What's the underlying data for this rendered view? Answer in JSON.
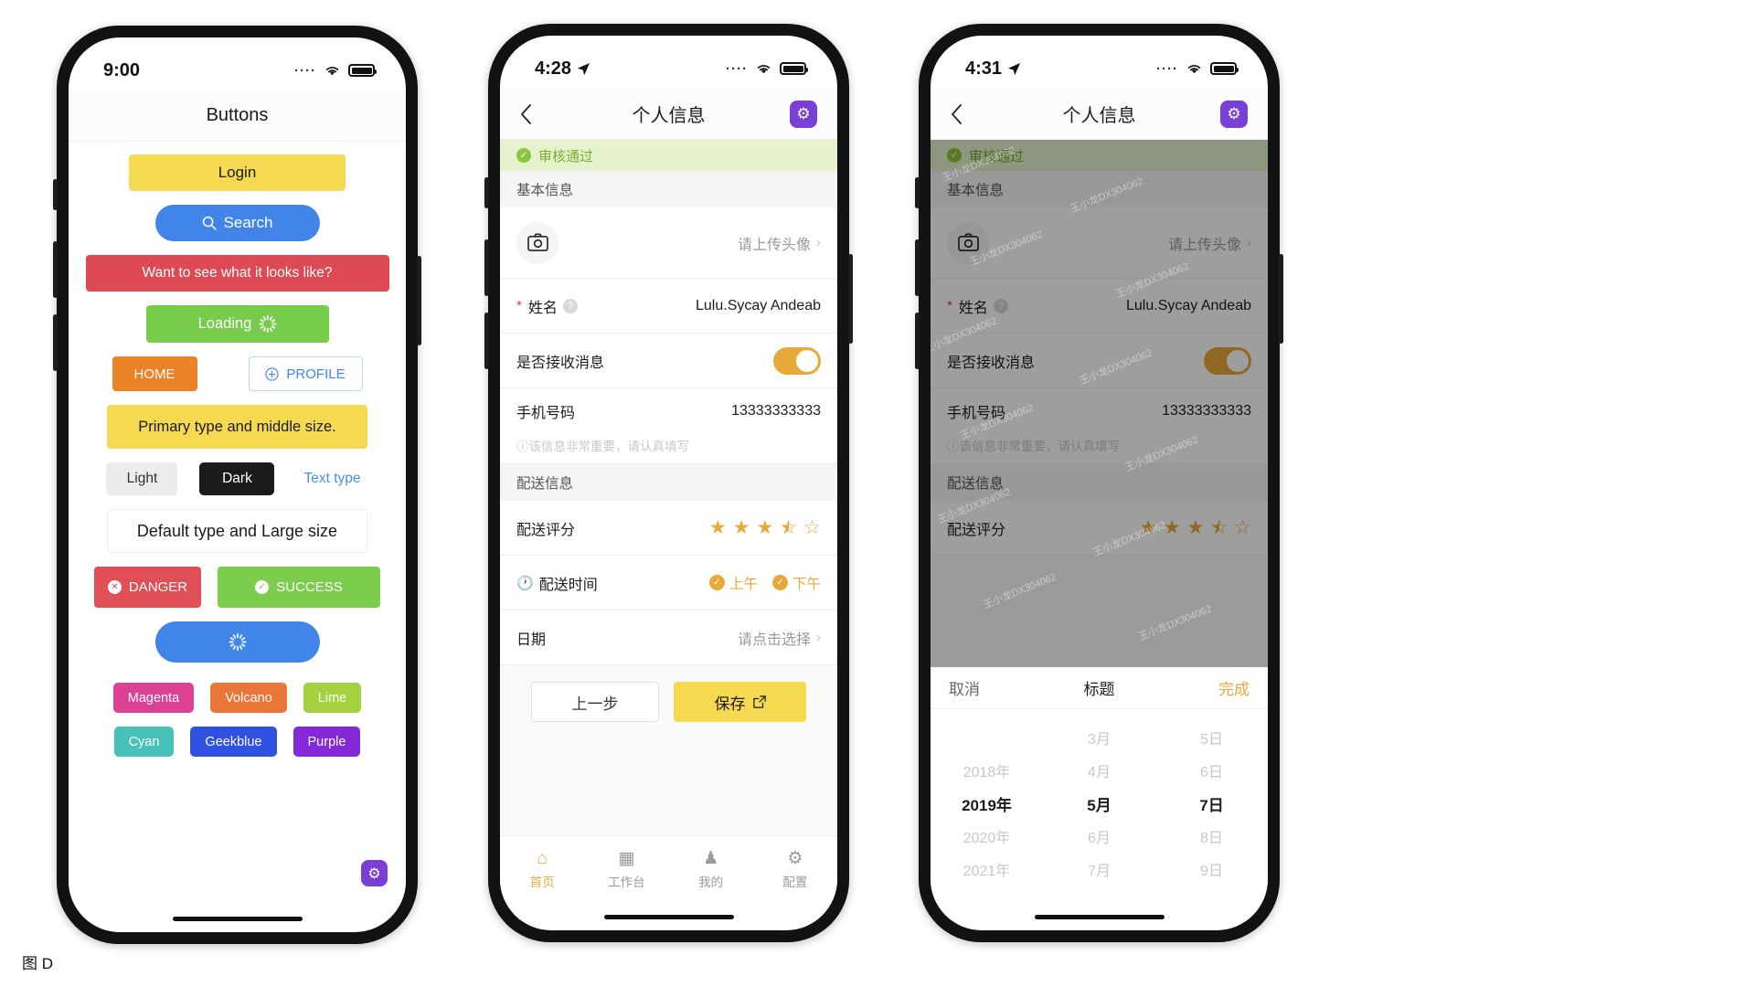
{
  "caption": "图 D",
  "phone1": {
    "status": {
      "time": "9:00",
      "dots": "····",
      "wifi_icon": "wifi-icon",
      "battery_icon": "battery-icon"
    },
    "nav": {
      "back_icon": "chevron-left-icon",
      "title": "Buttons"
    },
    "buttons": {
      "login": "Login",
      "search": "Search",
      "search_icon": "search-icon",
      "want": "Want to see what it looks like?",
      "loading": "Loading",
      "loading_icon": "spinner-icon",
      "home": "HOME",
      "profile": "PROFILE",
      "profile_icon": "plus-circle-icon",
      "primary_mid": "Primary type and middle size.",
      "light": "Light",
      "dark": "Dark",
      "text_type": "Text type",
      "default_large": "Default type and Large size",
      "danger": "DANGER",
      "danger_icon": "close-circle-icon",
      "success": "SUCCESS",
      "success_icon": "check-circle-icon",
      "big_blue_icon": "spinner-icon"
    },
    "tags": [
      {
        "label": "Magenta",
        "color": "#dd4193"
      },
      {
        "label": "Volcano",
        "color": "#ea7538"
      },
      {
        "label": "Lime",
        "color": "#a5d040"
      },
      {
        "label": "Cyan",
        "color": "#48c1bb"
      },
      {
        "label": "Geekblue",
        "color": "#3050e0"
      },
      {
        "label": "Purple",
        "color": "#8428d8"
      }
    ],
    "fab_icon": "gear-icon"
  },
  "phone2": {
    "status": {
      "time": "4:28",
      "location_icon": "location-arrow-icon",
      "dots": "····",
      "wifi_icon": "wifi-icon",
      "battery_icon": "battery-icon"
    },
    "nav": {
      "back_icon": "chevron-left-icon",
      "title": "个人信息",
      "gear_icon": "gear-icon"
    },
    "notice": {
      "icon": "check-circle-icon",
      "text": "审核通过"
    },
    "section_basic": "基本信息",
    "rows": {
      "avatar_label_icon": "camera-icon",
      "avatar_value": "请上传头像",
      "avatar_chevron": "chevron-right-icon",
      "name_required": "*",
      "name_label": "姓名",
      "name_help_icon": "question-circle-icon",
      "name_value": "Lulu.Sycay Andeab",
      "switch_label": "是否接收消息",
      "switch_state": "on",
      "phone_label": "手机号码",
      "phone_value": "13333333333",
      "phone_hint_icon": "info-circle-icon",
      "phone_hint": "该信息非常重要，请认真填写"
    },
    "section_delivery": "配送信息",
    "rating": {
      "label": "配送评分",
      "value": 3.5,
      "max": 5
    },
    "delivery_time": {
      "icon": "clock-icon",
      "label": "配送时间",
      "options": [
        {
          "label": "上午",
          "checked": true
        },
        {
          "label": "下午",
          "checked": true
        }
      ]
    },
    "date": {
      "label": "日期",
      "placeholder": "请点击选择",
      "chevron": "chevron-right-icon"
    },
    "actions": {
      "prev": "上一步",
      "save": "保存",
      "save_icon": "export-icon"
    },
    "tabs": [
      {
        "icon": "home-icon",
        "label": "首页",
        "active": true
      },
      {
        "icon": "grid-icon",
        "label": "工作台",
        "active": false
      },
      {
        "icon": "user-icon",
        "label": "我的",
        "active": false
      },
      {
        "icon": "gear-icon",
        "label": "配置",
        "active": false
      }
    ]
  },
  "phone3": {
    "status": {
      "time": "4:31",
      "location_icon": "location-arrow-icon",
      "dots": "····",
      "wifi_icon": "wifi-icon",
      "battery_icon": "battery-icon"
    },
    "nav": {
      "back_icon": "chevron-left-icon",
      "title": "个人信息",
      "gear_icon": "gear-icon"
    },
    "notice": {
      "icon": "check-circle-icon",
      "text": "审核通过"
    },
    "section_basic": "基本信息",
    "rows": {
      "avatar_label_icon": "camera-icon",
      "avatar_value": "请上传头像",
      "avatar_chevron": "chevron-right-icon",
      "name_required": "*",
      "name_label": "姓名",
      "name_help_icon": "question-circle-icon",
      "name_value": "Lulu.Sycay Andeab",
      "switch_label": "是否接收消息",
      "switch_state": "on",
      "phone_label": "手机号码",
      "phone_value": "13333333333",
      "phone_hint_icon": "info-circle-icon",
      "phone_hint": "该信息非常重要，请认真填写"
    },
    "section_delivery": "配送信息",
    "rating": {
      "label": "配送评分",
      "value": 3.5,
      "max": 5
    },
    "watermark_text": "王小龙DX304062",
    "picker": {
      "cancel": "取消",
      "title": "标题",
      "done": "完成",
      "columns": [
        {
          "name": "year",
          "items": [
            "",
            "2018年",
            "2019年",
            "2020年",
            "2021年"
          ],
          "selected_index": 2
        },
        {
          "name": "month",
          "items": [
            "3月",
            "4月",
            "5月",
            "6月",
            "7月"
          ],
          "selected_index": 2
        },
        {
          "name": "day",
          "items": [
            "5日",
            "6日",
            "7日",
            "8日",
            "9日"
          ],
          "selected_index": 2
        }
      ]
    }
  }
}
